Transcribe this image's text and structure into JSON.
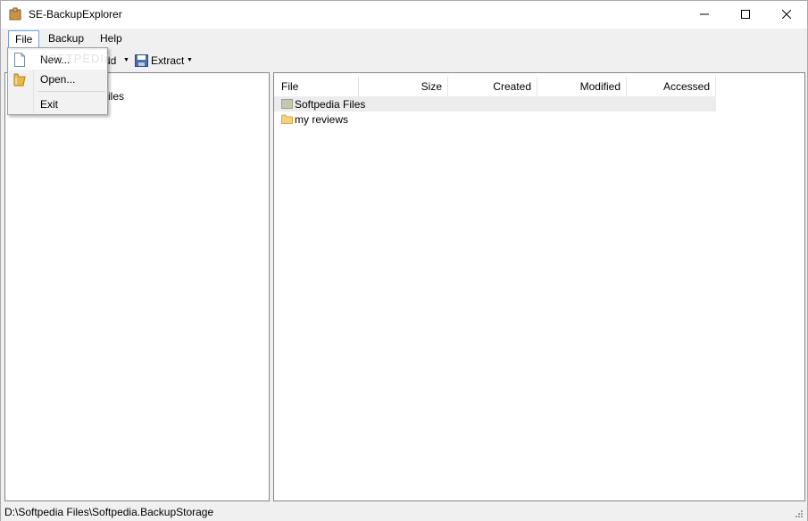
{
  "window": {
    "title": "SE-BackupExplorer"
  },
  "menubar": {
    "file": "File",
    "backup": "Backup",
    "help": "Help"
  },
  "toolbar": {
    "add_label": "dd",
    "extract_label": "Extract"
  },
  "file_menu": {
    "new": "New...",
    "open": "Open...",
    "exit": "Exit"
  },
  "tree": {
    "visible_label": "iles"
  },
  "list": {
    "columns": [
      "File",
      "Size",
      "Created",
      "Modified",
      "Accessed"
    ],
    "rows": [
      {
        "name": "Softpedia Files",
        "icon": "generic-folder-icon"
      },
      {
        "name": "my reviews",
        "icon": "folder-icon"
      }
    ]
  },
  "statusbar": {
    "path": "D:\\Softpedia Files\\Softpedia.BackupStorage"
  },
  "watermark": "SOFTPEDIA",
  "colors": {
    "selection": "#ececec",
    "folder": "#f5d27a",
    "menu_highlight": "#7a9fd0"
  }
}
